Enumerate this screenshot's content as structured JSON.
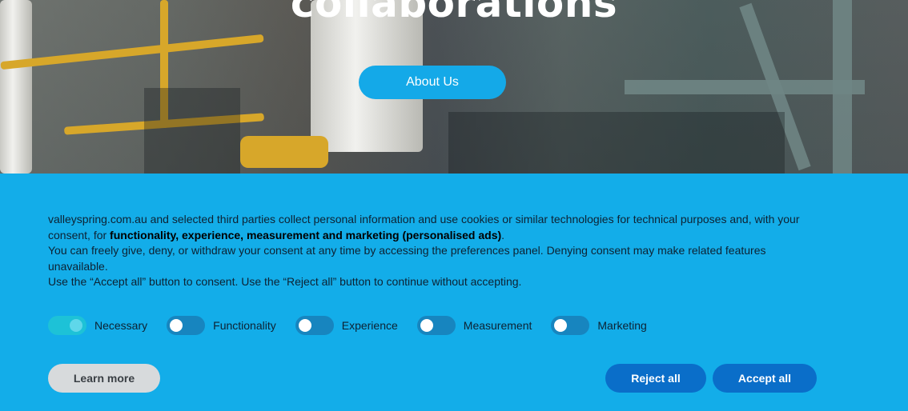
{
  "hero": {
    "title": "collaborations",
    "about_button": "About Us"
  },
  "consent": {
    "site": "valleyspring.com.au",
    "line1_pre": "valleyspring.com.au and selected third parties collect personal information and use cookies or similar technologies for technical purposes and, with your consent, for ",
    "line1_bold": "functionality, experience, measurement and marketing (personalised ads)",
    "line1_post": ".",
    "line2": "You can freely give, deny, or withdraw your consent at any time by accessing the preferences panel. Denying consent may make related features unavailable.",
    "line3": "Use the “Accept all” button to consent. Use the “Reject all” button to continue without accepting.",
    "toggles": [
      {
        "label": "Necessary",
        "on": true
      },
      {
        "label": "Functionality",
        "on": false
      },
      {
        "label": "Experience",
        "on": false
      },
      {
        "label": "Measurement",
        "on": false
      },
      {
        "label": "Marketing",
        "on": false
      }
    ],
    "learn_more": "Learn more",
    "reject_all": "Reject all",
    "accept_all": "Accept all"
  },
  "colors": {
    "banner_bg": "#13ade9",
    "primary_button": "#0a6ec9",
    "hero_button": "#14a9e8"
  }
}
